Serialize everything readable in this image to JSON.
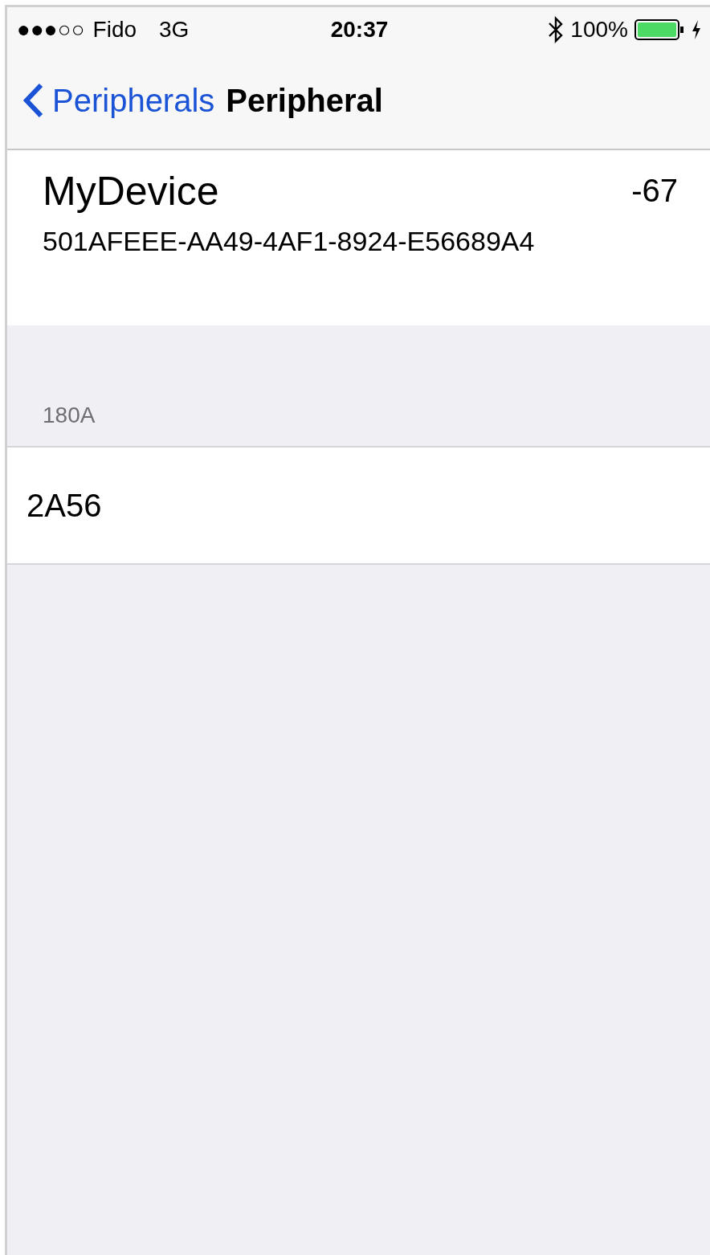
{
  "status_bar": {
    "signal": "●●●○○",
    "carrier": "Fido",
    "network": "3G",
    "time": "20:37",
    "battery": "100%"
  },
  "nav_bar": {
    "back": "Peripherals",
    "title": "Peripheral"
  },
  "device": {
    "name": "MyDevice",
    "rssi": "-67",
    "uuid": "501AFEEE-AA49-4AF1-8924-E56689A4"
  },
  "services": [
    {
      "header": "180A",
      "characteristics": [
        "2A56"
      ]
    }
  ]
}
